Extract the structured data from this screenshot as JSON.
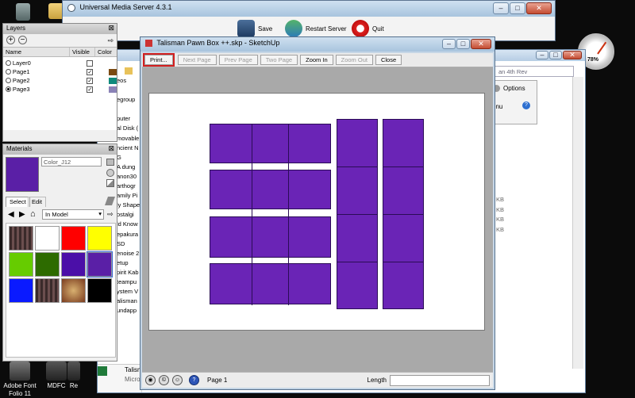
{
  "desktop": {
    "icons": [
      {
        "label": "Adobe Font Folio 11"
      },
      {
        "label": "MDFC"
      },
      {
        "label": "Re"
      }
    ],
    "gauge_percent": "78%"
  },
  "ums": {
    "title": "Universal Media Server 4.3.1",
    "save_label": "Save",
    "restart_label": "Restart Server",
    "quit_label": "Quit",
    "close_glyph": "✕"
  },
  "explorer": {
    "address_fragment": "an 4th Rev",
    "options_label": "Options",
    "menu_fragment": "enu",
    "tree_items": [
      "eos",
      "",
      "egroup",
      "",
      "puter",
      "al Disk (",
      "movable",
      "ncient N",
      "G",
      "A dung",
      "anon30",
      "arthogr",
      "amily Pi",
      "ly Shape",
      "ostalgi",
      "ld Know",
      "epakura",
      "SD",
      "enoise 2",
      "etup",
      "pirit Kab",
      "teampu",
      "ystem V",
      "alisman",
      "undapp"
    ],
    "kb_labels": [
      "KB",
      "KB",
      "KB",
      "KB"
    ]
  },
  "taskbar": {
    "item_label": "Talism",
    "item_sub": "Micro"
  },
  "layers": {
    "title": "Layers",
    "col_name": "Name",
    "col_visible": "Visible",
    "col_color": "Color",
    "rows": [
      {
        "name": "Layer0",
        "active": false,
        "visible": false,
        "color": ""
      },
      {
        "name": "Page1",
        "active": false,
        "visible": true,
        "color": "#7b4a12"
      },
      {
        "name": "Page2",
        "active": false,
        "visible": true,
        "color": "#0f8a7c"
      },
      {
        "name": "Page3",
        "active": true,
        "visible": true,
        "color": "#8a82b6"
      }
    ]
  },
  "materials": {
    "title": "Materials",
    "name_value": "Color_J12",
    "tab_select": "Select",
    "tab_edit": "Edit",
    "library_value": "In Model",
    "current_color": "#5a1fa6",
    "swatches": [
      "texture",
      "#ffffff",
      "#ff0000",
      "#ffff00",
      "#66cc00",
      "#2d6b00",
      "#4b0fa8",
      "#5a1fa6",
      "#0a1aff",
      "texture",
      "texture2",
      "#000000"
    ]
  },
  "preview": {
    "title": "Talisman Pawn Box ++.skp - SketchUp",
    "buttons": [
      {
        "label": "Print...",
        "enabled": true,
        "highlight": true
      },
      {
        "label": "Next Page",
        "enabled": false,
        "highlight": false
      },
      {
        "label": "Prev Page",
        "enabled": false,
        "highlight": false
      },
      {
        "label": "Two Page",
        "enabled": false,
        "highlight": false
      },
      {
        "label": "Zoom In",
        "enabled": true,
        "highlight": false
      },
      {
        "label": "Zoom Out",
        "enabled": false,
        "highlight": false
      },
      {
        "label": "Close",
        "enabled": true,
        "highlight": false
      }
    ],
    "status_page": "Page 1",
    "status_length": "Length",
    "piece_color": "#6a24b6"
  }
}
